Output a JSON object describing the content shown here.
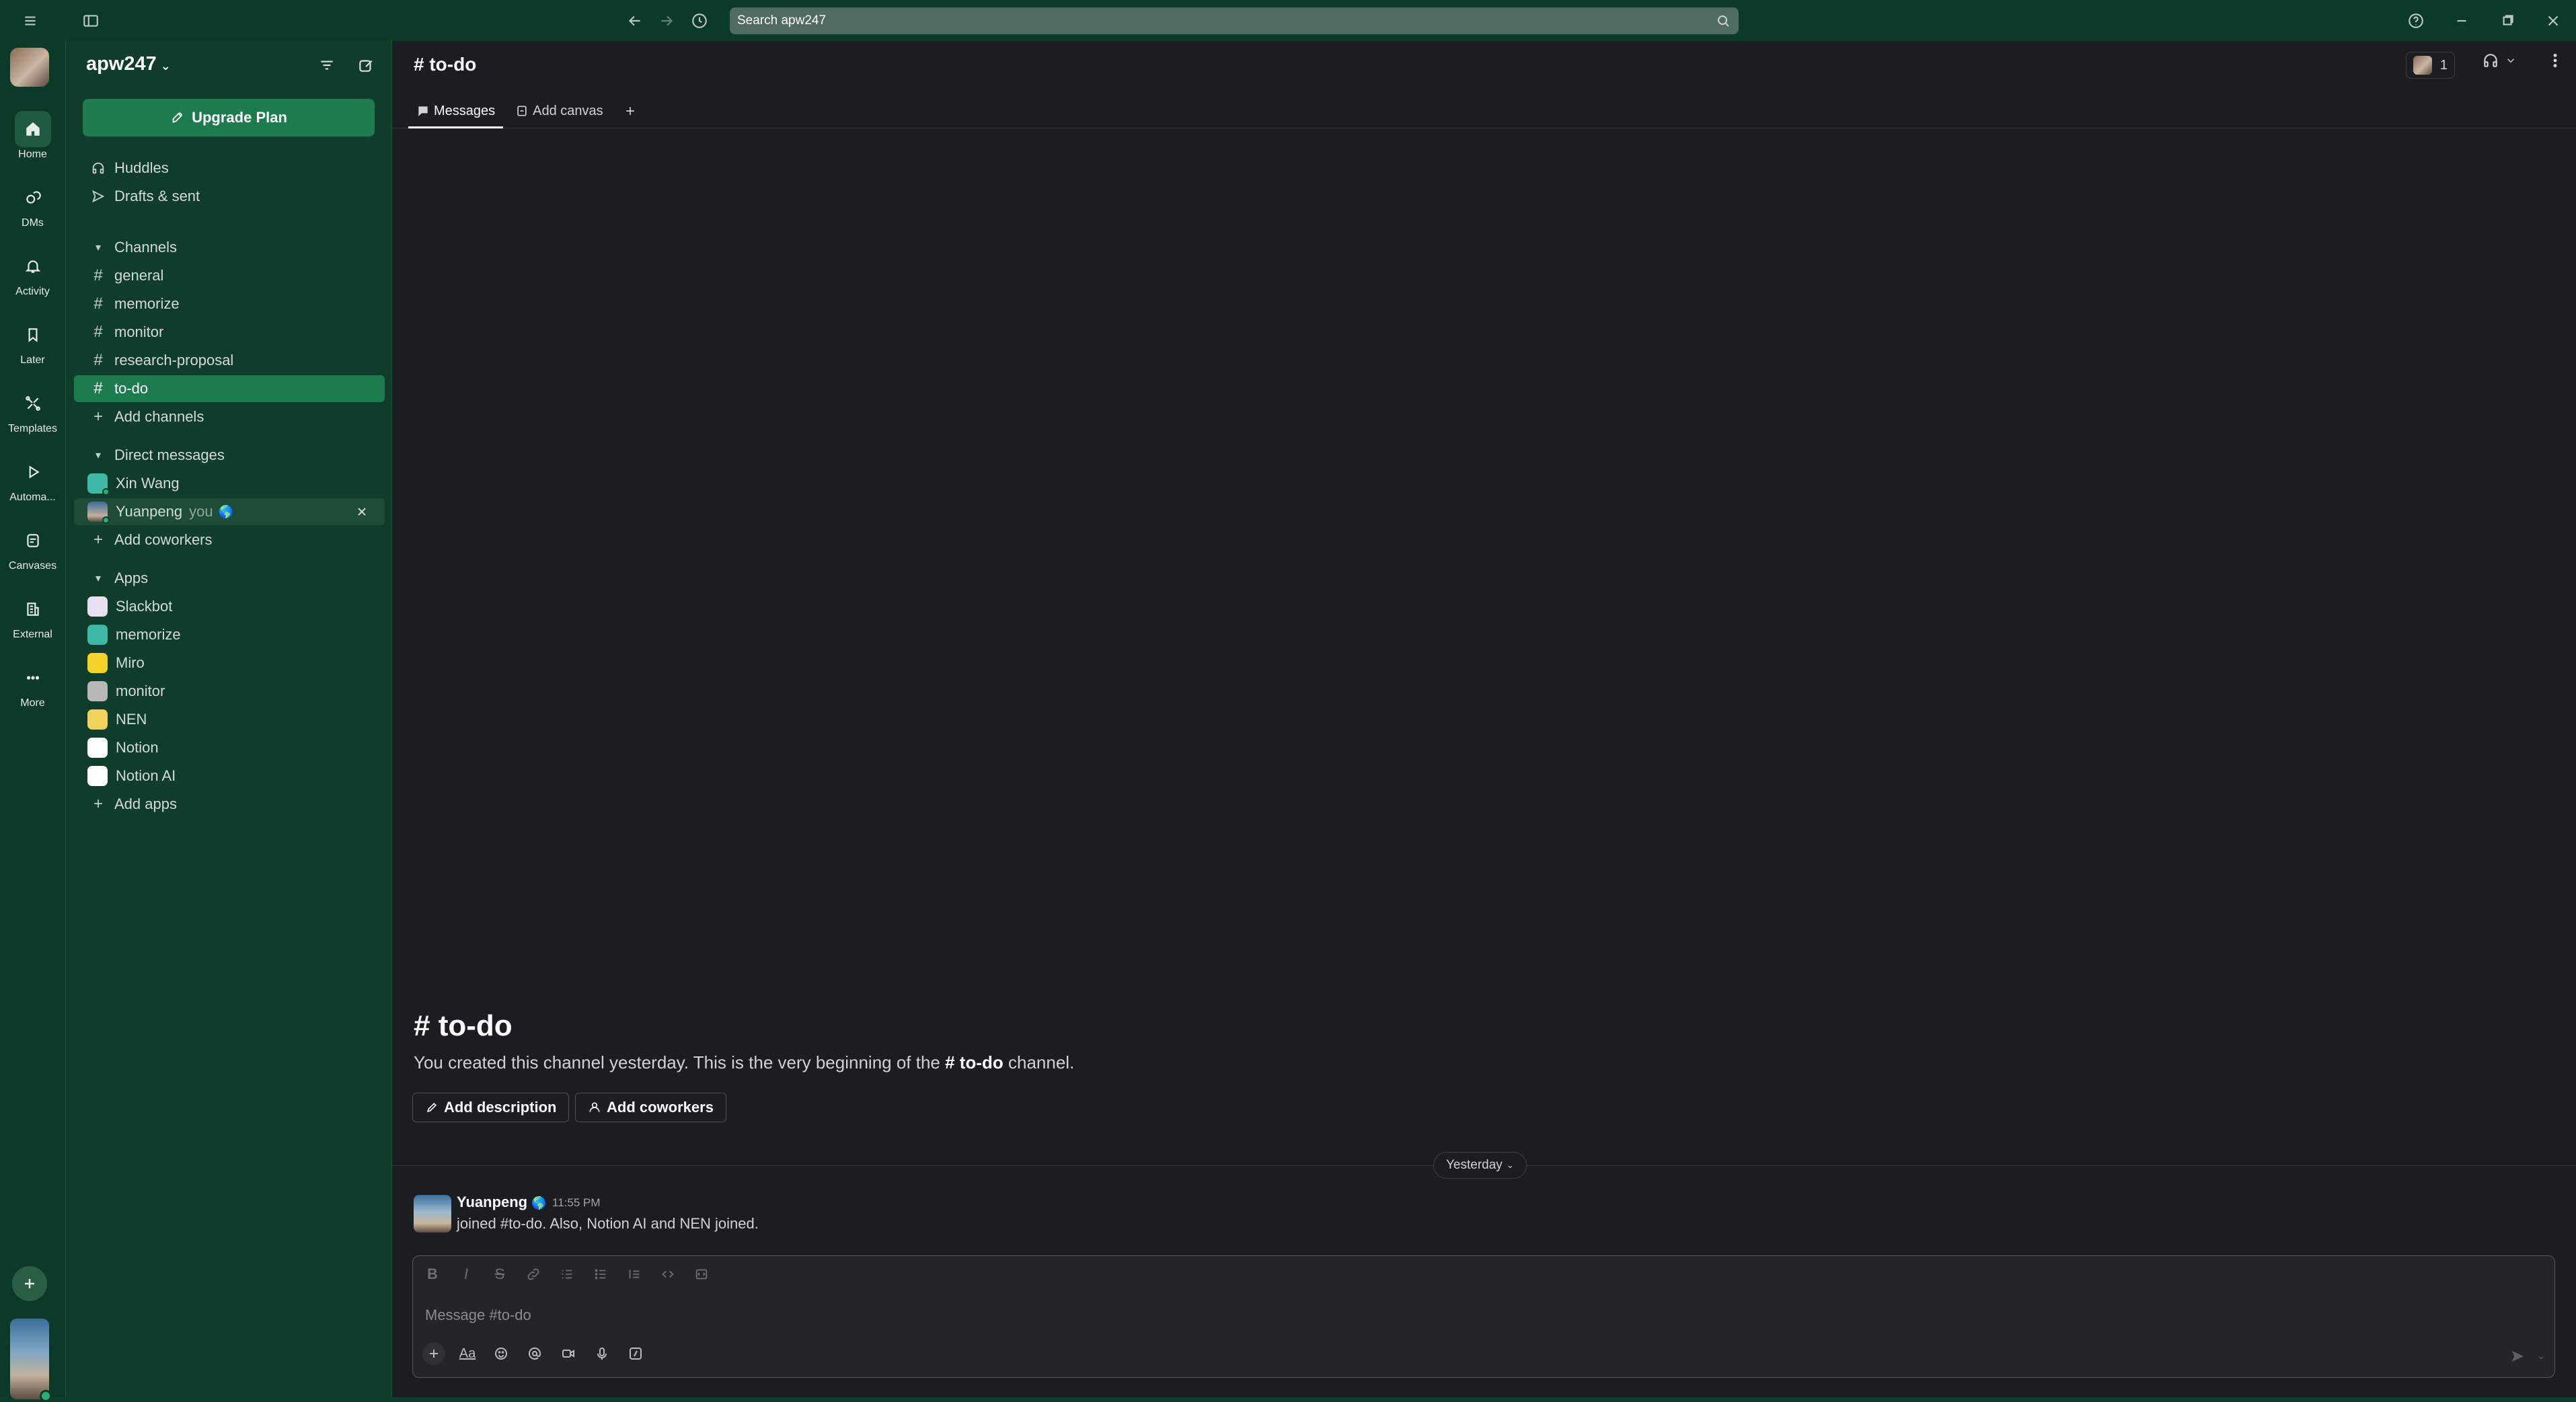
{
  "titlebar": {
    "search_placeholder": "Search apw247"
  },
  "rail": {
    "items": [
      {
        "label": "Home",
        "icon": "home-icon"
      },
      {
        "label": "DMs",
        "icon": "dms-icon"
      },
      {
        "label": "Activity",
        "icon": "bell-icon"
      },
      {
        "label": "Later",
        "icon": "bookmark-icon"
      },
      {
        "label": "Templates",
        "icon": "templates-icon"
      },
      {
        "label": "Automa...",
        "icon": "play-icon"
      },
      {
        "label": "Canvases",
        "icon": "canvas-icon"
      },
      {
        "label": "External",
        "icon": "building-icon"
      },
      {
        "label": "More",
        "icon": "more-icon"
      }
    ]
  },
  "sidebar": {
    "workspace_name": "apw247",
    "upgrade_label": "Upgrade Plan",
    "top_items": [
      {
        "label": "Huddles"
      },
      {
        "label": "Drafts & sent"
      }
    ],
    "channels_section": "Channels",
    "channels": [
      "general",
      "memorize",
      "monitor",
      "research-proposal",
      "to-do"
    ],
    "add_channels": "Add channels",
    "dm_section": "Direct messages",
    "dms": [
      {
        "name": "Xin Wang"
      },
      {
        "name": "Yuanpeng",
        "suffix": "you",
        "emoji": "🌎"
      }
    ],
    "add_coworkers": "Add coworkers",
    "apps_section": "Apps",
    "apps": [
      {
        "name": "Slackbot",
        "color": "#e8e0f0"
      },
      {
        "name": "memorize",
        "color": "#3fb8a6"
      },
      {
        "name": "Miro",
        "color": "#f5d328"
      },
      {
        "name": "monitor",
        "color": "#b8b8b8"
      },
      {
        "name": "NEN",
        "color": "#f2d15c"
      },
      {
        "name": "Notion",
        "color": "#ffffff"
      },
      {
        "name": "Notion AI",
        "color": "#ffffff"
      }
    ],
    "add_apps": "Add apps"
  },
  "channel": {
    "title": "# to-do",
    "tabs": [
      "Messages",
      "Add canvas"
    ],
    "member_count": "1",
    "intro_title": "# to-do",
    "intro_text_pre": "You created this channel yesterday. This is the very beginning of the ",
    "intro_text_channel": "# to-do",
    "intro_text_post": " channel.",
    "add_description": "Add description",
    "add_coworkers": "Add coworkers",
    "date_divider": "Yesterday",
    "message": {
      "author": "Yuanpeng",
      "author_emoji": "🌎",
      "time": "11:55 PM",
      "body": "joined #to-do. Also, Notion AI and NEN joined."
    },
    "composer_placeholder": "Message #to-do"
  },
  "colors": {
    "sidebar_bg": "#0f3d2a",
    "accent": "#1e7a4f",
    "main_bg": "#1a1d21"
  }
}
